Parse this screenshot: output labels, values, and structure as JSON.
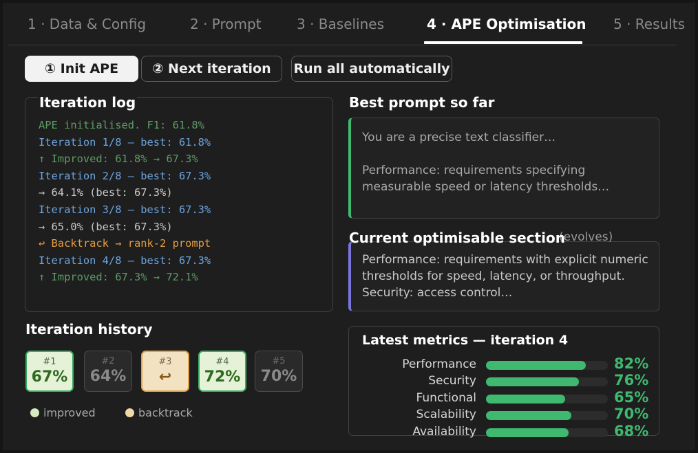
{
  "tabs": [
    {
      "label": "1 · Data & Config"
    },
    {
      "label": "2 · Prompt"
    },
    {
      "label": "3 · Baselines"
    },
    {
      "label": "4 · APE Optimisation"
    },
    {
      "label": "5 · Results"
    }
  ],
  "active_tab": 3,
  "buttons": {
    "init": "① Init APE",
    "next": "② Next iteration",
    "auto": "Run all automatically"
  },
  "iteration_log": {
    "title": "Iteration log",
    "lines": [
      {
        "text": "APE initialised. F1: 61.8%",
        "kind": "green"
      },
      {
        "text": "Iteration 1/8 — best: 61.8%",
        "kind": "blue"
      },
      {
        "text": "↑ Improved: 61.8% → 67.3%",
        "kind": "green"
      },
      {
        "text": "Iteration 2/8 — best: 67.3%",
        "kind": "blue"
      },
      {
        "text": "→ 64.1% (best: 67.3%)",
        "kind": "gray"
      },
      {
        "text": "Iteration 3/8 — best: 67.3%",
        "kind": "blue"
      },
      {
        "text": "→ 65.0% (best: 67.3%)",
        "kind": "gray"
      },
      {
        "text": "↩ Backtrack → rank-2 prompt",
        "kind": "orange"
      },
      {
        "text": "Iteration 4/8 — best: 67.3%",
        "kind": "blue"
      },
      {
        "text": "↑ Improved: 67.3% → 72.1%",
        "kind": "green"
      }
    ]
  },
  "history": {
    "title": "Iteration history",
    "items": [
      {
        "num": "#1",
        "value": "67%",
        "status": "improved"
      },
      {
        "num": "#2",
        "value": "64%",
        "status": "neutral"
      },
      {
        "num": "#3",
        "value": "↩",
        "status": "backtrack"
      },
      {
        "num": "#4",
        "value": "72%",
        "status": "improved"
      },
      {
        "num": "#5",
        "value": "70%",
        "status": "neutral"
      }
    ],
    "legend": [
      {
        "label": "improved",
        "color": "#d6ebc2"
      },
      {
        "label": "backtrack",
        "color": "#f0d9a8"
      }
    ]
  },
  "best_prompt": {
    "title": "Best prompt so far",
    "line1": "You are a precise text classifier…",
    "line2": "Performance: requirements specifying measurable speed or latency thresholds…",
    "accent": "#3fb870"
  },
  "current_section": {
    "title": "Current optimisable section",
    "subtitle": "(evolves)",
    "text": "Performance: requirements with explicit numeric thresholds for speed, latency, or throughput. Security: access control…",
    "accent": "#7b74dd"
  },
  "metrics": {
    "title": "Latest metrics — iteration 4",
    "rows": [
      {
        "label": "Performance",
        "value": 82,
        "display": "82%"
      },
      {
        "label": "Security",
        "value": 76,
        "display": "76%"
      },
      {
        "label": "Functional",
        "value": 65,
        "display": "65%"
      },
      {
        "label": "Scalability",
        "value": 70,
        "display": "70%"
      },
      {
        "label": "Availability",
        "value": 68,
        "display": "68%"
      }
    ],
    "bar_color": "#3fb870"
  }
}
